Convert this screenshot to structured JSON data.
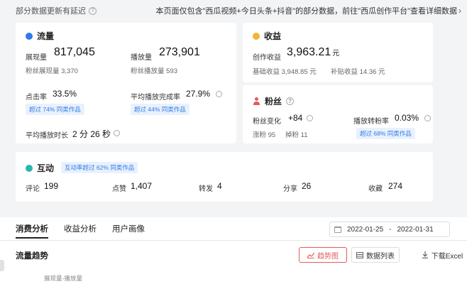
{
  "header": {
    "left_note": "部分数据更新有延迟",
    "right_note": "本页面仅包含\"西瓜视频+今日头条+抖音\"的部分数据，前往\"西瓜创作平台\"查看详细数据",
    "right_chevron": "›"
  },
  "flow": {
    "title": "流量",
    "impressions_label": "展现量",
    "impressions_value": "817,045",
    "fan_impressions": "粉丝展现量 3,370",
    "plays_label": "播放量",
    "plays_value": "273,901",
    "fan_plays": "粉丝播放量 593",
    "ctr_label": "点击率",
    "ctr_value": "33.5%",
    "ctr_badge": "超过 74% 同类作品",
    "completion_label": "平均播放完成率",
    "completion_value": "27.9%",
    "completion_badge": "超过 44% 同类作品",
    "avg_duration_label": "平均播放时长",
    "avg_duration_value": "2 分 26 秒"
  },
  "income": {
    "title": "收益",
    "creation_label": "创作收益",
    "creation_value": "3,963.21",
    "creation_unit": "元",
    "base_income": "基础收益 3,948.85 元",
    "subsidy_income": "补贴收益 14.36 元"
  },
  "fans": {
    "title": "粉丝",
    "change_label": "粉丝变化",
    "change_value": "+84",
    "gained": "涨粉 95",
    "lost": "掉粉 11",
    "conversion_label": "播放转粉率",
    "conversion_value": "0.03%",
    "conversion_badge": "超过 68% 同类作品"
  },
  "interaction": {
    "title": "互动",
    "badge": "互动率超过 62% 同类作品",
    "comments_label": "评论",
    "comments_value": "199",
    "likes_label": "点赞",
    "likes_value": "1,407",
    "reposts_label": "转发",
    "reposts_value": "4",
    "shares_label": "分享",
    "shares_value": "26",
    "favorites_label": "收藏",
    "favorites_value": "274"
  },
  "tabs": [
    "消费分析",
    "收益分析",
    "用户画像"
  ],
  "date_range": {
    "start": "2022-01-25",
    "separator": "-",
    "end": "2022-01-31"
  },
  "trend": {
    "title": "流量趋势",
    "trend_button": "趋势图",
    "table_button": "数据列表",
    "download_button": "下载Excel",
    "legend_hint": "展现量-播放量"
  },
  "colors": {
    "accent_blue": "#2f7ce8",
    "accent_red": "#e35b5b",
    "income_gold": "#f2b431",
    "interact_teal": "#2bb7b0"
  }
}
